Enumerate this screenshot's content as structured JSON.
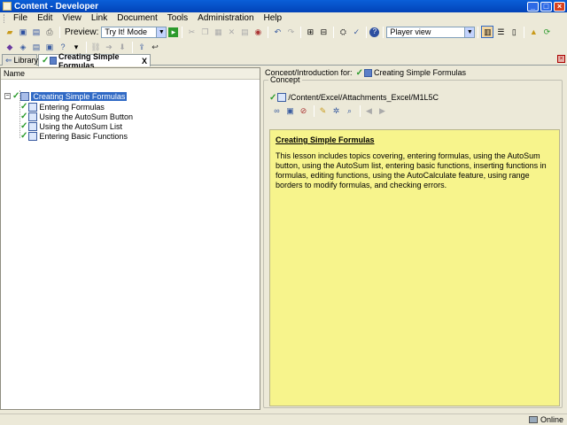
{
  "window": {
    "title": "Content - Developer"
  },
  "menu": [
    "File",
    "Edit",
    "View",
    "Link",
    "Document",
    "Tools",
    "Administration",
    "Help"
  ],
  "toolbar": {
    "preview_label": "Preview:",
    "preview_mode": "Try It! Mode",
    "view_mode": "Player view"
  },
  "tabs": [
    {
      "label": "Library",
      "active": false
    },
    {
      "label": "Creating Simple Formulas",
      "active": true
    }
  ],
  "outline": {
    "column_header": "Name",
    "nodes": [
      {
        "label": "Creating Simple Formulas",
        "selected": true
      },
      {
        "label": "Entering Formulas"
      },
      {
        "label": "Using the AutoSum Button"
      },
      {
        "label": "Using the AutoSum List"
      },
      {
        "label": "Entering Basic Functions"
      }
    ]
  },
  "concept": {
    "header_label": "Concept/Introduction for:",
    "header_doc": "Creating Simple Formulas",
    "group_label": "Concept",
    "path": "/Content/Excel/Attachments_Excel/M1L5C",
    "heading": "Creating Simple Formulas",
    "body": "This lesson includes topics covering, entering formulas, using the AutoSum button, using the AutoSum list, entering basic functions, inserting functions in formulas, editing functions, using the AutoCalculate feature, using range borders to modify formulas, and checking errors."
  },
  "status": {
    "connection": "Online"
  }
}
